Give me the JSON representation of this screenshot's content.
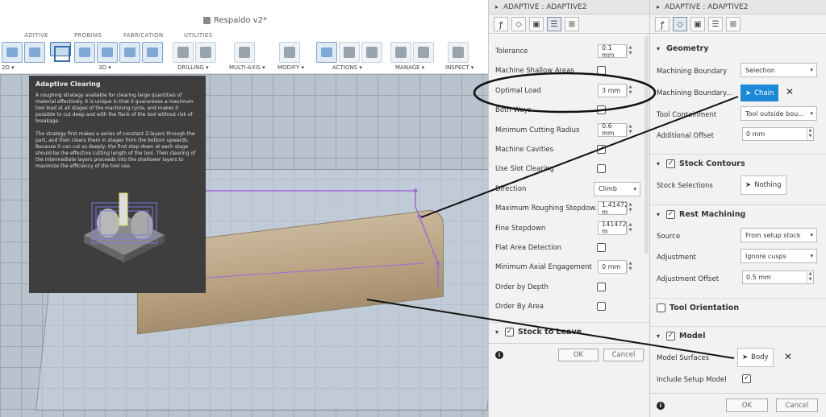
{
  "toolbar": {
    "doc_title": "Respaldo v2*",
    "sections": [
      "ADITIVE",
      "PROBING",
      "FABRICATION",
      "UTILITIES"
    ],
    "buttons": [
      "2D ▾",
      "3D ▾",
      "DRILLING ▾",
      "MULTI-AXIS ▾",
      "MODIFY ▾",
      "ACTIONS ▾",
      "MANAGE ▾",
      "INSPECT ▾"
    ]
  },
  "tooltip": {
    "title": "Adaptive Clearing",
    "p1": "A roughing strategy available for clearing large quantities of material effectively. It is unique in that it guarantees a maximum tool load at all stages of the machining cycle, and makes it possible to cut deep and with the flank of the tool without risk of breakage.",
    "p2": "The strategy first makes a series of constant Z-layers through the part, and then clears them in stages from the bottom upwards. Because it can cut so deeply, the first step down at each stage should be the effective cutting length of the tool. Then clearing of the intermediate layers proceeds into the shallower layers to maximize the efficiency of the tool use."
  },
  "panel_mid": {
    "title": "ADAPTIVE : ADAPTIVE2",
    "rows": [
      {
        "label": "Tolerance",
        "type": "input",
        "value": "0.1 mm"
      },
      {
        "label": "Machine Shallow Areas",
        "type": "check",
        "checked": false
      },
      {
        "label": "Optimal Load",
        "type": "input",
        "value": "3 mm"
      },
      {
        "label": "Both Ways",
        "type": "check",
        "checked": false
      },
      {
        "label": "Minimum Cutting Radius",
        "type": "input",
        "value": "0.6 mm"
      },
      {
        "label": "Machine Cavities",
        "type": "check",
        "checked": true
      },
      {
        "label": "Use Slot Clearing",
        "type": "check",
        "checked": false
      },
      {
        "label": "Direction",
        "type": "select",
        "value": "Climb"
      },
      {
        "label": "Maximum Roughing Stepdow.",
        "type": "input",
        "value": "1.41472 m"
      },
      {
        "label": "Fine Stepdown",
        "type": "input",
        "value": "141472 m"
      },
      {
        "label": "Flat Area Detection",
        "type": "check",
        "checked": false
      },
      {
        "label": "Minimum Axial Engagement",
        "type": "input",
        "value": "0 mm"
      },
      {
        "label": "Order by Depth",
        "type": "check",
        "checked": false
      },
      {
        "label": "Order By Area",
        "type": "check",
        "checked": false
      }
    ],
    "section": "Stock to Leave",
    "ok": "OK",
    "cancel": "Cancel"
  },
  "panel_right": {
    "title": "ADAPTIVE : ADAPTIVE2",
    "geometry": "Geometry",
    "machining_boundary_label": "Machining Boundary",
    "machining_boundary_value": "Selection",
    "machining_boundary_sel_label": "Machining Boundary...",
    "chain": "Chain",
    "tool_containment_label": "Tool Containment",
    "tool_containment_value": "Tool outside bou...",
    "additional_offset_label": "Additional Offset",
    "additional_offset_value": "0 mm",
    "stock_contours": "Stock Contours",
    "stock_selections_label": "Stock Selections",
    "nothing": "Nothing",
    "rest_machining": "Rest Machining",
    "source_label": "Source",
    "source_value": "From setup stock",
    "adjustment_label": "Adjustment",
    "adjustment_value": "Ignore cusps",
    "adjustment_offset_label": "Adjustment Offset",
    "adjustment_offset_value": "0.5 mm",
    "tool_orientation": "Tool Orientation",
    "model": "Model",
    "model_surfaces_label": "Model Surfaces",
    "body": "Body",
    "include_setup_model_label": "Include Setup Model",
    "ok": "OK",
    "cancel": "Cancel"
  }
}
